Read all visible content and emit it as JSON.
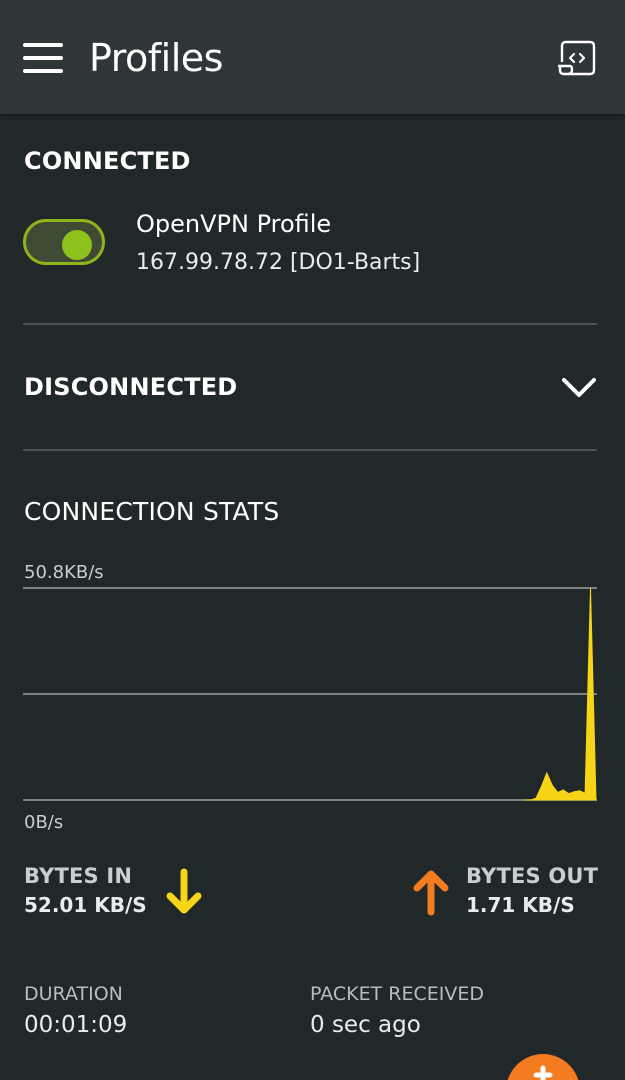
{
  "appbar": {
    "title": "Profiles",
    "menu_icon": "hamburger-menu-icon",
    "action_icon": "import-profile-icon"
  },
  "connected": {
    "title": "CONNECTED",
    "toggle_on": true,
    "profile_name": "OpenVPN Profile",
    "profile_server": "167.99.78.72 [DO1-Barts]"
  },
  "disconnected": {
    "title": "DISCONNECTED",
    "expand_icon": "chevron-down-icon"
  },
  "stats": {
    "title": "CONNECTION STATS",
    "bytes_in_label": "BYTES IN",
    "bytes_in_value": "52.01 KB/S",
    "bytes_out_label": "BYTES OUT",
    "bytes_out_value": "1.71 KB/S",
    "duration_label": "DURATION",
    "duration_value": "00:01:09",
    "packet_label": "PACKET RECEIVED",
    "packet_value": "0 sec ago"
  },
  "chart_data": {
    "type": "area",
    "y_max_label": "50.8KB/s",
    "y_min_label": "0B/s",
    "ylim": [
      0,
      50.8
    ],
    "grid": true,
    "x": [
      0,
      1,
      2,
      3,
      4,
      5,
      6,
      7,
      8,
      9,
      10,
      11,
      12,
      13
    ],
    "values": [
      0,
      0,
      0.4,
      3.2,
      6.5,
      3.5,
      1.8,
      2.4,
      1.5,
      2.0,
      2.2,
      1.6,
      50.8,
      0
    ],
    "fill_color": "#f6d417"
  },
  "colors": {
    "background": "#212829",
    "appbar": "#2f3638",
    "toggle_accent": "#8cc21b",
    "bytes_in_arrow": "#f6d417",
    "bytes_out_arrow": "#f47b20",
    "fab": "#f47b20"
  },
  "fab": {
    "icon": "plus-icon"
  }
}
